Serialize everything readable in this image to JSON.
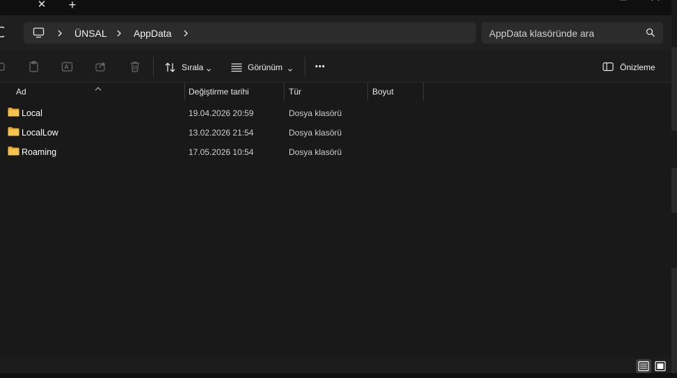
{
  "tabs": {
    "close_glyph": "✕",
    "new_glyph": "+"
  },
  "address": {
    "segments": [
      "ÜNSAL",
      "AppData"
    ]
  },
  "search": {
    "placeholder": "AppData klasöründe ara"
  },
  "commandbar": {
    "sort_label": "Sırala",
    "view_label": "Görünüm",
    "more_label": "•••",
    "preview_label": "Önizleme"
  },
  "columns": {
    "name": "Ad",
    "modified": "Değiştirme tarihi",
    "type": "Tür",
    "size": "Boyut"
  },
  "files": [
    {
      "name": "Local",
      "modified": "19.04.2026 20:59",
      "type": "Dosya klasörü",
      "size": ""
    },
    {
      "name": "LocalLow",
      "modified": "13.02.2026 21:54",
      "type": "Dosya klasörü",
      "size": ""
    },
    {
      "name": "Roaming",
      "modified": "17.05.2026 10:54",
      "type": "Dosya klasörü",
      "size": ""
    }
  ],
  "colors": {
    "folder": "#f4c44e",
    "background": "#191919",
    "toolbar": "#1c1c1c"
  }
}
